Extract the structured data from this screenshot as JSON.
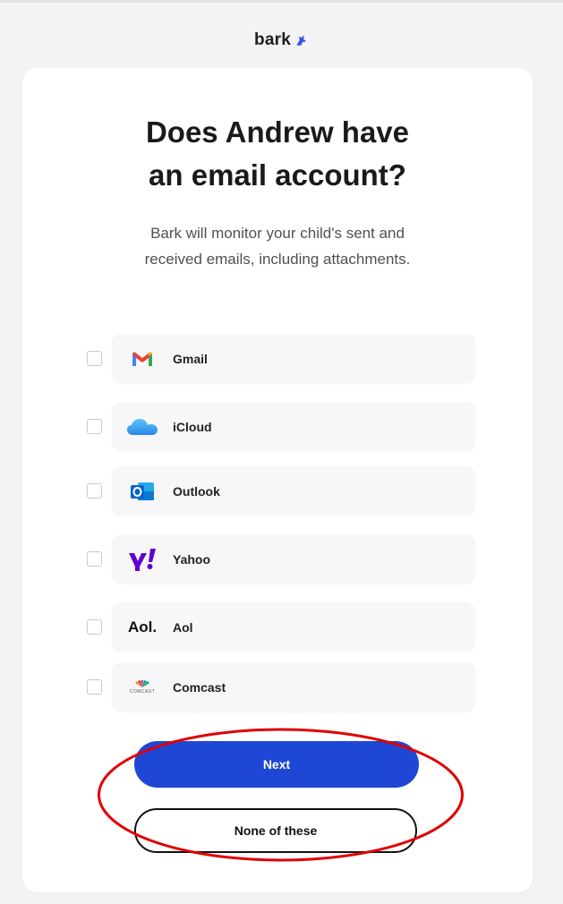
{
  "brand": {
    "name": "bark",
    "icon": "bark-dog-icon",
    "icon_color": "#2f55e0"
  },
  "heading": {
    "line1": "Does Andrew have",
    "line2": "an email account?"
  },
  "subtitle": {
    "line1": "Bark will monitor your child's sent and",
    "line2": "received emails, including attachments."
  },
  "options": [
    {
      "label": "Gmail",
      "icon": "gmail-icon",
      "checked": false
    },
    {
      "label": "iCloud",
      "icon": "icloud-icon",
      "checked": false
    },
    {
      "label": "Outlook",
      "icon": "outlook-icon",
      "checked": false
    },
    {
      "label": "Yahoo",
      "icon": "yahoo-icon",
      "checked": false
    },
    {
      "label": "Aol",
      "icon": "aol-icon",
      "logo_text": "Aol.",
      "checked": false
    },
    {
      "label": "Comcast",
      "icon": "comcast-icon",
      "logo_text": "COMCAST",
      "checked": false
    }
  ],
  "actions": {
    "next_label": "Next",
    "none_label": "None of these"
  },
  "colors": {
    "primary": "#1f47d6",
    "annotation": "#e00000",
    "yahoo": "#6001d2",
    "outlook": "#0a64c9"
  }
}
